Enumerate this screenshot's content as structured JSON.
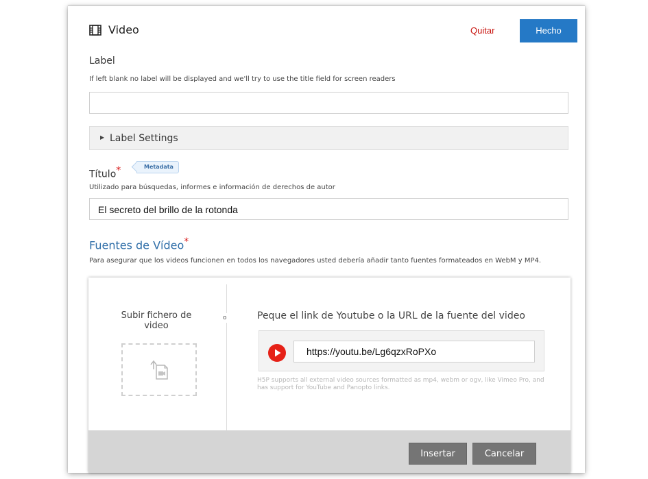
{
  "header": {
    "icon": "film-icon",
    "title": "Video",
    "remove_label": "Quitar",
    "done_label": "Hecho"
  },
  "label_field": {
    "label": "Label",
    "help": "If left blank no label will be displayed and we'll try to use the title field for screen readers",
    "value": ""
  },
  "label_settings": {
    "label": "Label Settings"
  },
  "title_field": {
    "label": "Título",
    "required_mark": "*",
    "tag": "Metadata",
    "help": "Utilizado para búsquedas, informes e información de derechos de autor",
    "value": "El secreto del brillo de la rotonda"
  },
  "sources": {
    "title": "Fuentes de Vídeo",
    "required_mark": "*",
    "help": "Para asegurar que los videos funcionen en todos los navegadores usted debería añadir tanto fuentes formateados en WebM y MP4."
  },
  "upload_dialog": {
    "upload_title": "Subir fichero de video",
    "or": "o",
    "url_heading": "Peque el link de Youtube o la URL de la fuente del video",
    "url_value": "https://youtu.be/Lg6qzxRoPXo",
    "support_note": "H5P supports all external video sources formatted as mp4, webm or ogv, like Vimeo Pro, and has support for YouTube and Panopto links.",
    "insert_label": "Insertar",
    "cancel_label": "Cancelar"
  },
  "colors": {
    "done_button": "#2579c6",
    "remove_link": "#c8140f",
    "required": "#d81a1a",
    "sources_title": "#2f6ea8",
    "youtube_red": "#e62117"
  }
}
